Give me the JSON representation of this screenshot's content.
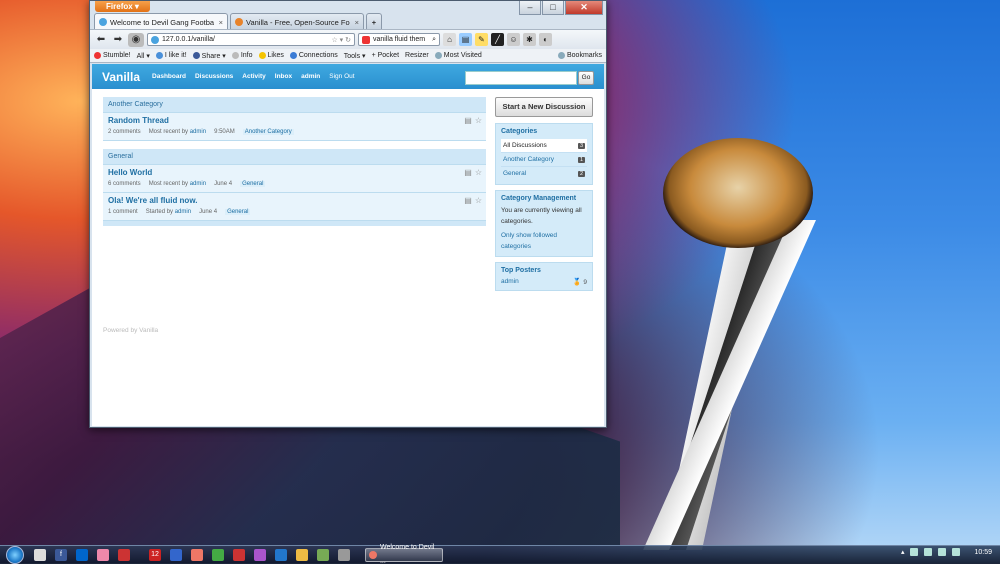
{
  "browser": {
    "menu_label": "Firefox",
    "win_min": "–",
    "win_max": "□",
    "win_close": "✕",
    "tabs": [
      {
        "label": "Welcome to Devil Gang Football F...",
        "active": true
      },
      {
        "label": "Vanilla - Free, Open-Source Foru...",
        "active": false
      }
    ],
    "new_tab": "+",
    "tab_close": "×",
    "url": "127.0.0.1/vanilla/",
    "search_value": "vanilla fluid them",
    "bookmarks": [
      "Stumble!",
      "All ▾",
      "I like it!",
      "Share ▾",
      "Info",
      "Likes",
      "Connections",
      "Tools ▾",
      "+ Pocket",
      "Resizer",
      "Most Visited"
    ],
    "bookmarks_right": "Bookmarks"
  },
  "vanilla": {
    "logo": "Vanilla",
    "nav": [
      "Dashboard",
      "Discussions",
      "Activity",
      "Inbox",
      "admin",
      "Sign Out"
    ],
    "search_button": "Go",
    "categories": [
      {
        "name": "Another Category",
        "discussions": [
          {
            "title": "Random Thread",
            "count": "2 comments",
            "label": "Most recent by",
            "user": "admin",
            "time": "9:50AM",
            "category": "Another Category"
          }
        ]
      },
      {
        "name": "General",
        "discussions": [
          {
            "title": "Hello World",
            "count": "6 comments",
            "label": "Most recent by",
            "user": "admin",
            "time": "June 4",
            "category": "General"
          },
          {
            "title": "Ola! We're all fluid now.",
            "count": "1 comment",
            "label": "Started by",
            "user": "admin",
            "time": "June 4",
            "category": "General"
          }
        ]
      }
    ],
    "powered_by": "Powered by Vanilla",
    "sidebar": {
      "new_discussion": "Start a New Discussion",
      "categories_title": "Categories",
      "categories": [
        {
          "name": "All Discussions",
          "count": "3",
          "selected": true
        },
        {
          "name": "Another Category",
          "count": "1",
          "selected": false
        },
        {
          "name": "General",
          "count": "2",
          "selected": false
        }
      ],
      "mgmt_title": "Category Management",
      "mgmt_text": "You are currently viewing all categories.",
      "mgmt_link": "Only show followed categories",
      "posters_title": "Top Posters",
      "poster_name": "admin",
      "poster_score": "9"
    }
  },
  "taskbar": {
    "window_label": "Welcome to Devil ...",
    "clock": "10:59"
  }
}
